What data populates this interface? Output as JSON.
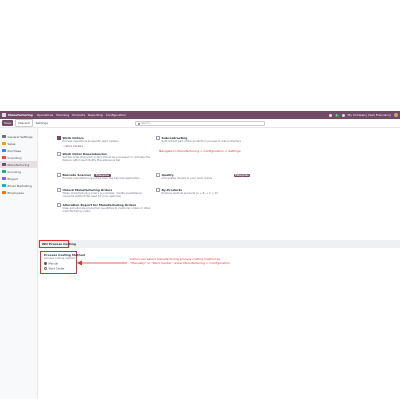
{
  "navbar": {
    "app_name": "Manufacturing",
    "menus": [
      "Operations",
      "Planning",
      "Products",
      "Reporting",
      "Configuration"
    ],
    "company": "My Company (San Francisco)",
    "badge": "1"
  },
  "control_panel": {
    "save_label": "Save",
    "discard_label": "Discard",
    "title": "Settings",
    "search_placeholder": "Search..."
  },
  "sidebar": {
    "items": [
      {
        "label": "General Settings",
        "color": "#6b7280"
      },
      {
        "label": "Sales",
        "color": "#f59e0b"
      },
      {
        "label": "Purchase",
        "color": "#3b82f6"
      },
      {
        "label": "Inventory",
        "color": "#ef4444"
      },
      {
        "label": "Manufacturing",
        "color": "#714b67"
      },
      {
        "label": "Invoicing",
        "color": "#10b981"
      },
      {
        "label": "Project",
        "color": "#8b5cf6"
      },
      {
        "label": "Email Marketing",
        "color": "#06b6d4"
      },
      {
        "label": "Employees",
        "color": "#f97316"
      }
    ]
  },
  "settings": {
    "work_orders": {
      "title": "Work Orders",
      "desc": "Process operations at specific work centers"
    },
    "work_centers_link": "Work Centers",
    "wo_dependencies": {
      "title": "Work Order Dependencies",
      "desc": "Set the order that work orders should be processed in. Activate the feature within each BoM's Miscellaneous tab"
    },
    "subcontracting": {
      "title": "Subcontracting",
      "desc": "Subcontract part of the production process to subcontractors"
    },
    "barcode_scanner": {
      "title": "Barcode Scanner",
      "desc": "Process manufacturing orders from the barcode application",
      "tag": "Enterprise"
    },
    "quality": {
      "title": "Quality",
      "desc": "Add quality checks to your work orders",
      "tag": "Enterprise"
    },
    "unlock_mo": {
      "title": "Unlock Manufacturing Orders",
      "desc": "When manufacturing orders is unlocked, modify quantities to consume without the need for prior approval"
    },
    "by_products": {
      "title": "By-Products",
      "desc": "Produce residual products (A + B -> C + D)"
    },
    "allocation": {
      "title": "Allocation Report for Manufacturing Orders",
      "desc": "View and allocate production quantities to customer orders or other manufacturing orders"
    }
  },
  "section": {
    "label": "WO Process Costing"
  },
  "costing": {
    "title": "Process Costing Method",
    "desc": "process costing method",
    "options": [
      "Manual",
      "Work Center"
    ],
    "selected": "Manual"
  },
  "annotations": {
    "navigate": "Navigate to Manufacturing > Configuration > Settings",
    "admin_note_1": "Admin can select manufacturing process costing method as",
    "admin_note_2": "\"Manually\" or \"Work Center\" under Manufacturing > Configuration"
  }
}
